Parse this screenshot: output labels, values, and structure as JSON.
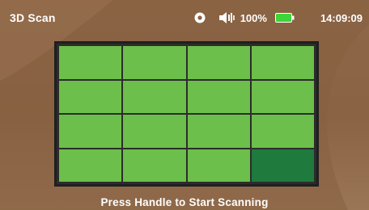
{
  "header": {
    "title": "3D Scan",
    "battery_percent": "100%",
    "time": "14:09:09"
  },
  "icons": {
    "settings": "gear-icon",
    "volume": "speaker-icon",
    "battery": "battery-icon"
  },
  "colors": {
    "background": "#8a6244",
    "cell_pending": "#6cbf4a",
    "cell_complete": "#1f7a3e",
    "grid_line": "#2c2c2c",
    "battery_fill": "#3fd43a"
  },
  "scan_grid": {
    "rows": 4,
    "columns": 4,
    "cells": [
      "pending",
      "pending",
      "pending",
      "pending",
      "pending",
      "pending",
      "pending",
      "pending",
      "pending",
      "pending",
      "pending",
      "pending",
      "pending",
      "pending",
      "pending",
      "complete"
    ]
  },
  "footer": {
    "prompt": "Press Handle to Start Scanning"
  }
}
